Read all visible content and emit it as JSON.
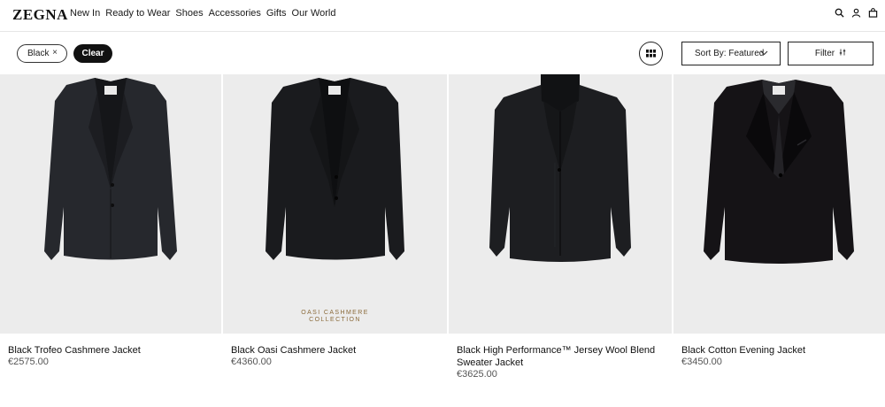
{
  "brand": "ZEGNA",
  "nav": [
    "New In",
    "Ready to Wear",
    "Shoes",
    "Accessories",
    "Gifts",
    "Our World"
  ],
  "header_icons": [
    "search-icon",
    "account-icon",
    "bag-icon"
  ],
  "filters": {
    "active_chip": "Black",
    "chip_remove": "×",
    "clear_label": "Clear",
    "sort_label": "Sort By: Featured",
    "filter_label": "Filter"
  },
  "products": [
    {
      "name": "Black Trofeo Cashmere Jacket",
      "price": "€2575.00",
      "badge": ""
    },
    {
      "name": "Black Oasi Cashmere Jacket",
      "price": "€4360.00",
      "badge_line1": "OASI CASHMERE",
      "badge_line2": "COLLECTION"
    },
    {
      "name": "Black High Performance™ Jersey Wool Blend Sweater Jacket",
      "price": "€3625.00",
      "badge": ""
    },
    {
      "name": "Black Cotton Evening Jacket",
      "price": "€3450.00",
      "badge": ""
    }
  ],
  "colors": {
    "accent": "#111111",
    "image_bg": "#ececec",
    "collection_text": "#8a6a3a"
  }
}
